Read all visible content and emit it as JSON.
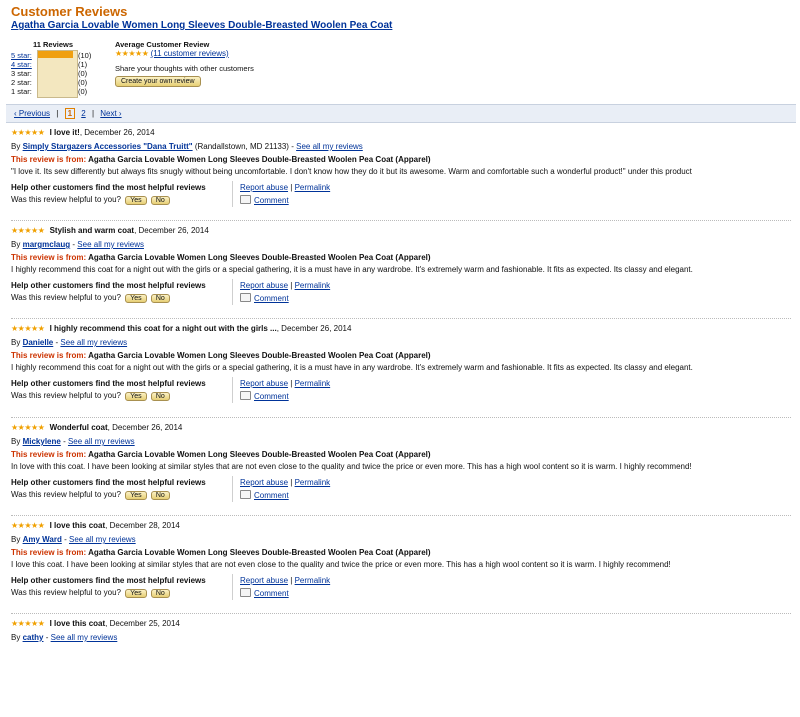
{
  "header": {
    "title": "Customer Reviews",
    "product": "Agatha Garcia Lovable Women Long Sleeves Double-Breasted Woolen Pea Coat"
  },
  "histogram": {
    "total_label": "11 Reviews",
    "rows": [
      {
        "label": "5 star:",
        "count": "(10)"
      },
      {
        "label": "4 star:",
        "count": "(1)"
      },
      {
        "label": "3 star:",
        "count": "(0)"
      },
      {
        "label": "2 star:",
        "count": "(0)"
      },
      {
        "label": "1 star:",
        "count": "(0)"
      }
    ],
    "fill_fraction": 0.91
  },
  "average": {
    "title": "Average Customer Review",
    "stars": "★★★★★",
    "count_link": "(11 customer reviews)",
    "share_text": "Share your thoughts with other customers",
    "create_button": "Create your own review"
  },
  "pager": {
    "prev": "‹ Previous",
    "current": "1",
    "page2": "2",
    "next": "Next ›",
    "separator": "|"
  },
  "common": {
    "stars": "★★★★★",
    "from_prefix": "This review is from:",
    "from_product": "Agatha Garcia Lovable Women Long Sleeves Double-Breasted Woolen Pea Coat (Apparel)",
    "help_label": "Help other customers find the most helpful reviews",
    "was_helpful": "Was this review helpful to you?",
    "yes": "Yes",
    "no": "No",
    "report_abuse": "Report abuse",
    "pipe": "|",
    "permalink": "Permalink",
    "comment": "Comment",
    "by": "By",
    "dash": "-",
    "see_all": "See all my reviews"
  },
  "reviews": [
    {
      "title": "I love it!",
      "date": ", December 26, 2014",
      "author": "Simply Stargazers Accessories \"Dana Truitt\"",
      "location": "(Randallstown, MD 21133)",
      "text": "\"I love it. Its sew differently but always fits snugly without being uncomfortable. I don't know how they do it but its awesome. Warm and comfortable such a wonderful product!\" under this product"
    },
    {
      "title": "Stylish and warm coat",
      "date": ", December 26, 2014",
      "author": "margmclaug",
      "location": "",
      "text": "I highly recommend this coat for a night out with the girls or a special gathering, it is a must have in any wardrobe. It's extremely warm and fashionable. It fits as expected. Its classy and elegant."
    },
    {
      "title": "I highly recommend this coat for a night out with the girls ...",
      "date": ", December 26, 2014",
      "author": "Danielle",
      "location": "",
      "text": "I highly recommend this coat for a night out with the girls or a special gathering, it is a must have in any wardrobe. It's extremely warm and fashionable. It fits as expected. Its classy and elegant."
    },
    {
      "title": "Wonderful coat",
      "date": ", December 26, 2014",
      "author": "Mickylene",
      "location": "",
      "text": "In love with this coat. I have been looking at similar styles that are not even close to the quality and twice the price or even more. This has a high wool content so it is warm. I highly recommend!"
    },
    {
      "title": "I love this coat",
      "date": ", December 28, 2014",
      "author": "Amy Ward",
      "location": "",
      "text": "I love this coat. I have been looking at similar styles that are not even close to the quality and twice the price or even more. This has a high wool content so it is warm. I highly recommend!"
    },
    {
      "title": "I love this coat",
      "date": ", December 25, 2014",
      "author": "cathy",
      "location": "",
      "text": ""
    }
  ]
}
